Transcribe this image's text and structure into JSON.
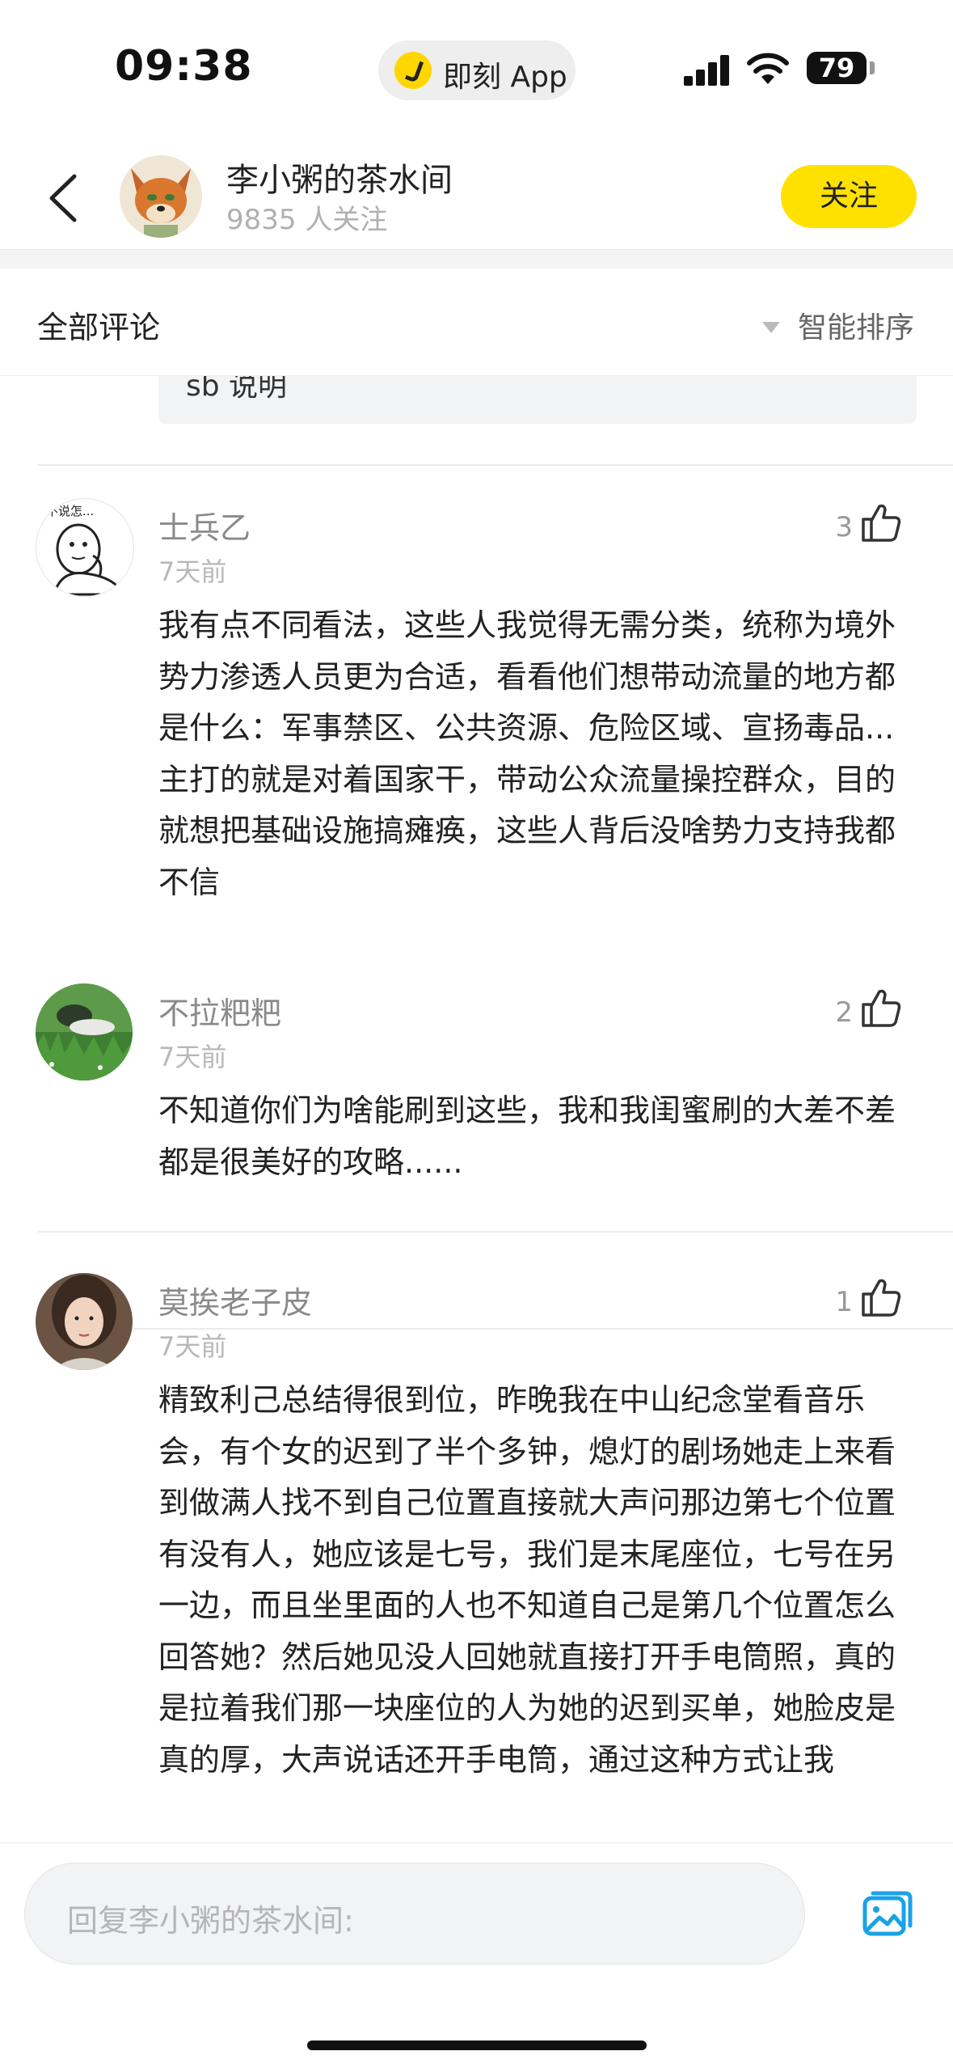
{
  "status_bar": {
    "time": "09:38",
    "app_label": "即刻 App",
    "battery": "79"
  },
  "header": {
    "channel_name": "李小粥的茶水间",
    "followers": "9835 人关注",
    "follow_label": "关注"
  },
  "comments_header": {
    "title": "全部评论",
    "sort_label": "智能排序"
  },
  "quoted_reply": {
    "text": "sb 说明"
  },
  "comments": [
    {
      "name": "士兵乙",
      "time": "7天前",
      "likes": "3",
      "avatar_caption": "不说怎...",
      "text": "我有点不同看法，这些人我觉得无需分类，统称为境外势力渗透人员更为合适，看看他们想带动流量的地方都是什么：军事禁区、公共资源、危险区域、宣扬毒品...主打的就是对着国家干，带动公众流量操控群众，目的就想把基础设施搞瘫痪，这些人背后没啥势力支持我都不信"
    },
    {
      "name": "不拉粑粑",
      "time": "7天前",
      "likes": "2",
      "text": "不知道你们为啥能刷到这些，我和我闺蜜刷的大差不差都是很美好的攻略......"
    },
    {
      "name": "莫挨老子皮",
      "time": "7天前",
      "likes": "1",
      "text": "精致利己总结得很到位，昨晚我在中山纪念堂看音乐会，有个女的迟到了半个多钟，熄灯的剧场她走上来看到做满人找不到自己位置直接就大声问那边第七个位置有没有人，她应该是七号，我们是末尾座位，七号在另一边，而且坐里面的人也不知道自己是第几个位置怎么回答她？然后她见没人回她就直接打开手电筒照，真的是拉着我们那一块座位的人为她的迟到买单，她脸皮是真的厚，大声说话还开手电筒，通过这种方式让我"
    }
  ],
  "reply_bar": {
    "placeholder": "回复李小粥的茶水间:"
  },
  "colors": {
    "accent": "#ffe100",
    "icon_blue": "#1aa2e6"
  }
}
